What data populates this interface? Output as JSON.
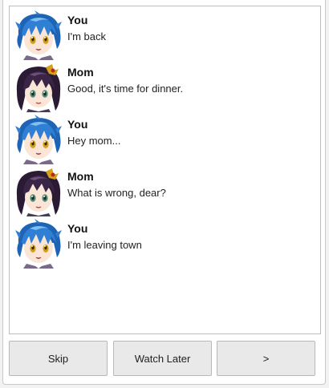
{
  "messages": [
    {
      "speaker": "You",
      "text": "I'm back",
      "avatar": "boy-avatar-icon"
    },
    {
      "speaker": "Mom",
      "text": "Good, it's time for dinner.",
      "avatar": "mom-avatar-icon"
    },
    {
      "speaker": "You",
      "text": "Hey mom...",
      "avatar": "boy-avatar-icon"
    },
    {
      "speaker": "Mom",
      "text": "What is wrong, dear?",
      "avatar": "mom-avatar-icon"
    },
    {
      "speaker": "You",
      "text": "I'm leaving town",
      "avatar": "boy-avatar-icon"
    }
  ],
  "buttons": {
    "skip": "Skip",
    "watch_later": "Watch Later",
    "next": ">"
  },
  "colors": {
    "boy_hair": "#2f7fd4",
    "mom_hair": "#3b2547",
    "skin": "#fbe5d6",
    "button_bg": "#e9e9e9"
  }
}
